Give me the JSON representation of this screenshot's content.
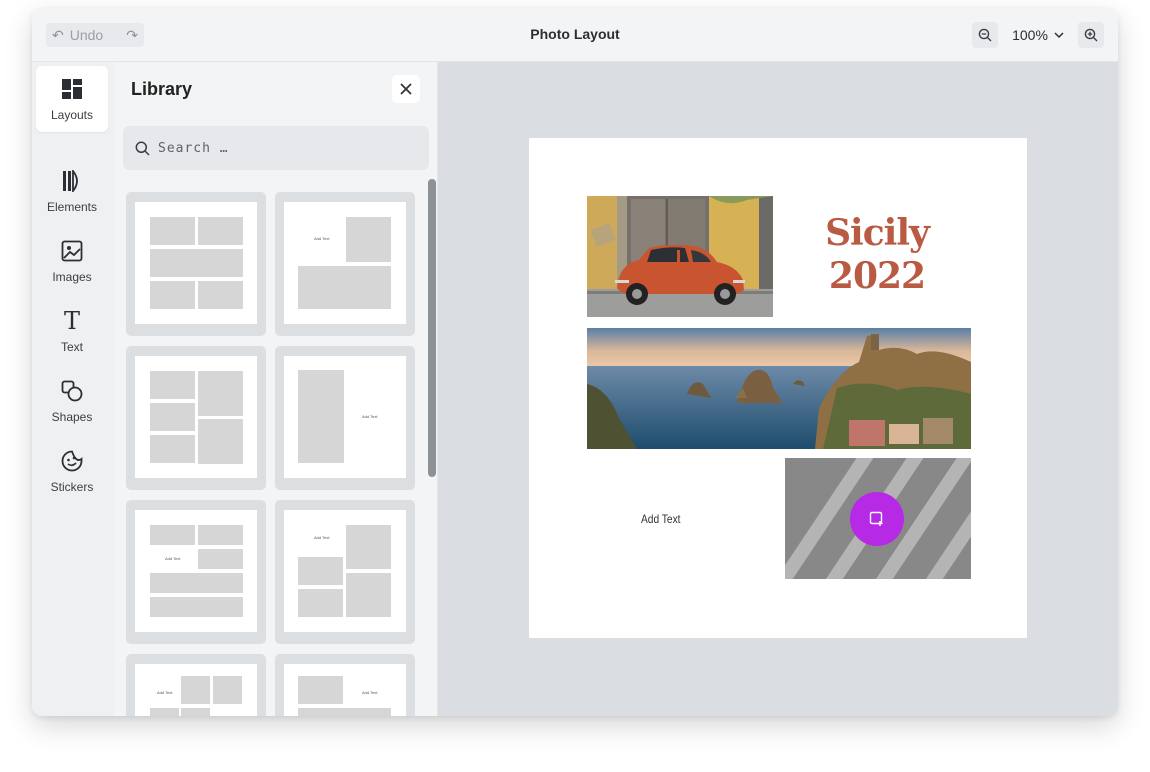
{
  "topbar": {
    "undo_label": "Undo",
    "title": "Photo Layout",
    "zoom_value": "100%"
  },
  "rail": {
    "items": [
      {
        "label": "Layouts",
        "icon": "layouts-icon",
        "active": true
      },
      {
        "label": "Elements",
        "icon": "elements-icon"
      },
      {
        "label": "Images",
        "icon": "image-icon"
      },
      {
        "label": "Text",
        "icon": "text-icon"
      },
      {
        "label": "Shapes",
        "icon": "shapes-icon"
      },
      {
        "label": "Stickers",
        "icon": "sticker-icon"
      }
    ]
  },
  "library": {
    "title": "Library",
    "search_placeholder": "Search …",
    "thumb_text": "Add Text"
  },
  "canvas": {
    "heading_line1": "Sicily",
    "heading_line2": "2022",
    "add_text": "Add Text"
  },
  "colors": {
    "accent": "#b62ae6",
    "heading": "#b95a42",
    "canvas_bg": "#dadde2"
  }
}
